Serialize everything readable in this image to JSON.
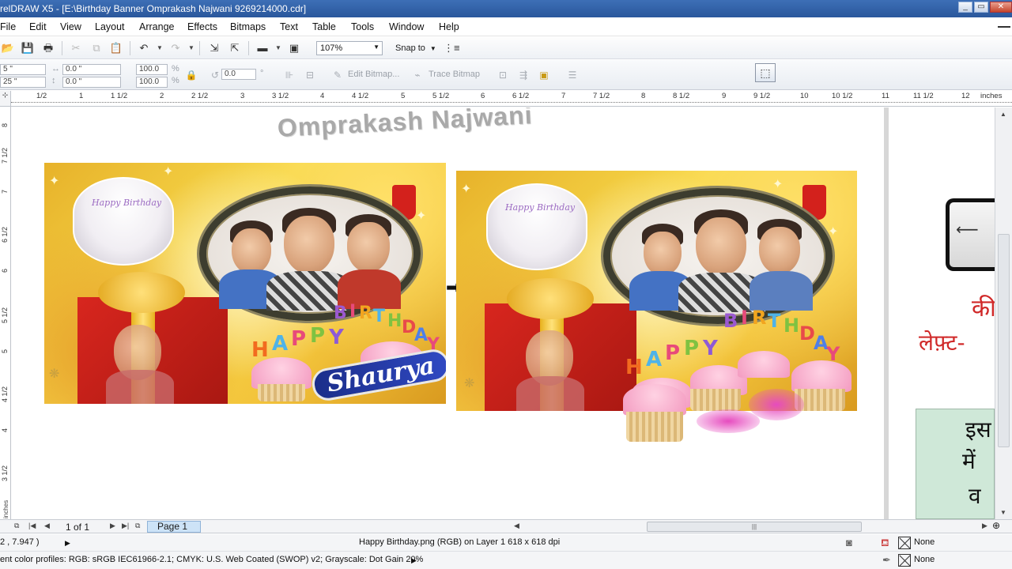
{
  "window": {
    "title": "relDRAW X5 - [E:\\Birthday Banner Omprakash Najwani 9269214000.cdr]",
    "controls": [
      "_",
      "▭",
      "✕"
    ]
  },
  "menu": [
    "File",
    "Edit",
    "View",
    "Layout",
    "Arrange",
    "Effects",
    "Bitmaps",
    "Text",
    "Table",
    "Tools",
    "Window",
    "Help"
  ],
  "toolbar": {
    "zoom_value": "107%",
    "snap_label": "Snap to"
  },
  "propbar": {
    "pos_x": "5 \"",
    "pos_y": "25 \"",
    "size_w": "0.0 \"",
    "size_h": "0.0 \"",
    "scale_w": "100.0",
    "scale_h": "100.0",
    "pct": "%",
    "rotate": "0.0",
    "deg": "°",
    "edit_bitmap": "Edit Bitmap...",
    "trace_bitmap": "Trace Bitmap"
  },
  "ruler": {
    "units": "inches",
    "h_labels": [
      "1/2",
      "1",
      "1 1/2",
      "2",
      "2 1/2",
      "3",
      "3 1/2",
      "4",
      "4 1/2",
      "5",
      "5 1/2",
      "6",
      "6 1/2",
      "7",
      "7 1/2",
      "8",
      "8 1/2",
      "9",
      "9 1/2",
      "10",
      "10 1/2",
      "11",
      "11 1/2",
      "12"
    ],
    "v_labels": [
      "8",
      "7 1/2",
      "7",
      "6 1/2",
      "6",
      "5 1/2",
      "5",
      "4 1/2",
      "4",
      "3 1/2"
    ]
  },
  "canvas": {
    "heading": "Omprakash Najwani",
    "cake_text": "Happy Birthday",
    "birthday_letters": [
      "B",
      "I",
      "R",
      "T",
      "H",
      "D",
      "A",
      "Y"
    ],
    "happy_letters": [
      "H",
      "A",
      "P",
      "P",
      "Y"
    ],
    "name_text": "Shaurya",
    "hindi_line1": "की",
    "hindi_line2": "लेफ़्ट-",
    "hindi_panel_lines": [
      "इस",
      "में",
      "व"
    ]
  },
  "pagebar": {
    "page_count": "1 of 1",
    "page_tab": "Page 1",
    "units_label": "inches"
  },
  "status": {
    "coords": "2 , 7.947 )",
    "object_info": "Happy Birthday.png (RGB) on Layer 1 618 x 618 dpi",
    "fill_label": "None",
    "outline_label": "None",
    "color_profiles": "ent color profiles: RGB: sRGB IEC61966-2.1; CMYK: U.S. Web Coated (SWOP) v2; Grayscale: Dot Gain 20%"
  },
  "colors": {
    "titlebar": "#2a579c",
    "accent_red": "#d02828",
    "page_tab": "#cde3f7"
  }
}
